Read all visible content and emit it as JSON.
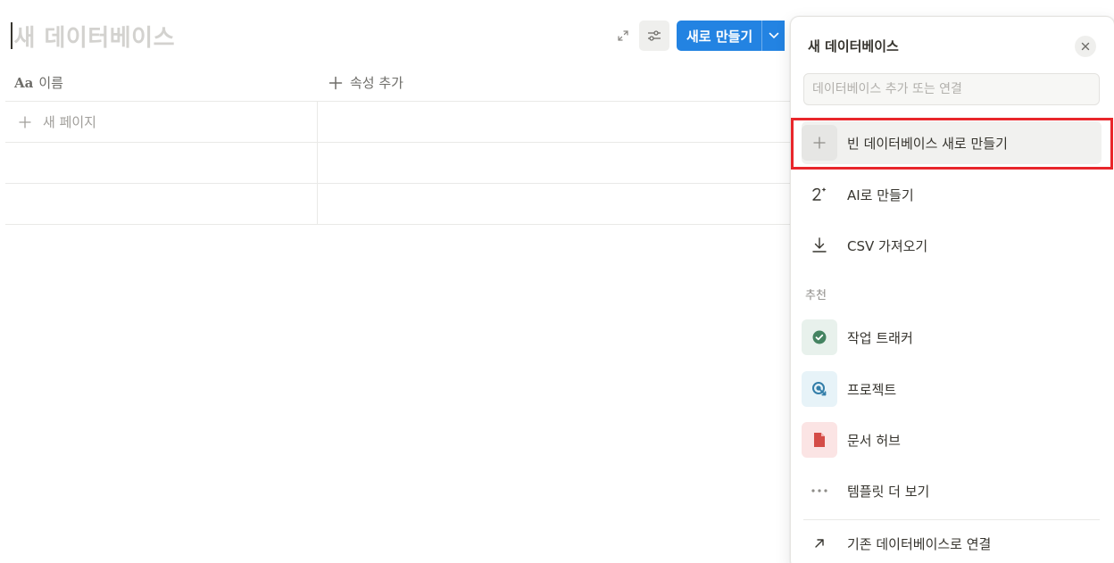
{
  "database": {
    "title": "새 데이터베이스",
    "columns": [
      {
        "icon": "Aa",
        "label": "이름"
      },
      {
        "label": "속성 추가"
      }
    ],
    "new_page_label": "새 페이지"
  },
  "toolbar": {
    "new_button_label": "새로 만들기"
  },
  "popup": {
    "title": "새 데이터베이스",
    "search_placeholder": "데이터베이스 추가 또는 연결",
    "items": [
      {
        "label": "빈 데이터베이스 새로 만들기",
        "icon": "plus-icon"
      },
      {
        "label": "AI로 만들기",
        "icon": "ai-sparkle-icon"
      },
      {
        "label": "CSV 가져오기",
        "icon": "download-icon"
      }
    ],
    "section_label": "추천",
    "templates": [
      {
        "label": "작업 트래커",
        "icon": "check-circle-icon",
        "color": "#448361",
        "bg": "#e8f1ec"
      },
      {
        "label": "프로젝트",
        "icon": "target-arrow-icon",
        "color": "#337ea9",
        "bg": "#e7f3f8"
      },
      {
        "label": "문서 허브",
        "icon": "document-icon",
        "color": "#d44c47",
        "bg": "#fbe4e4"
      }
    ],
    "more_templates_label": "템플릿 더 보기",
    "link_existing_label": "기존 데이터베이스로 연결"
  },
  "colors": {
    "accent": "#2383e2",
    "highlight_border": "#e8262b"
  }
}
